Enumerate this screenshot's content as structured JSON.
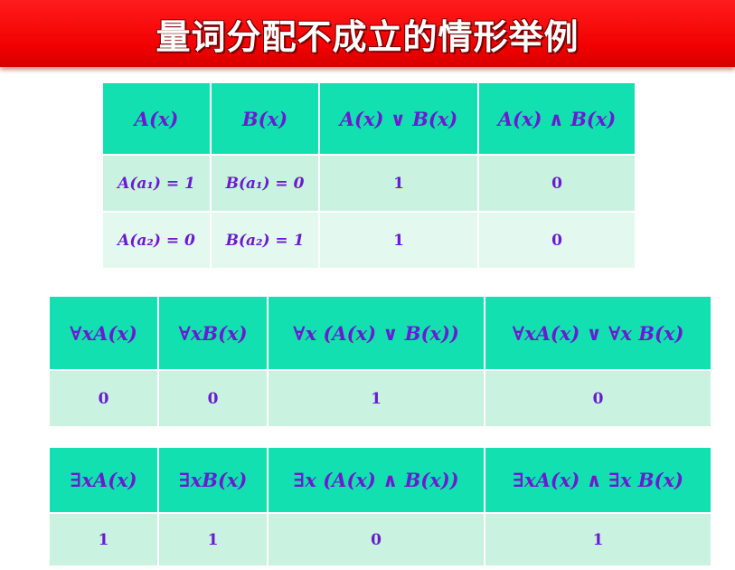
{
  "title": "量词分配不成立的情形举例",
  "colors": {
    "banner": "#f20000",
    "header_cell": "#12e0b0",
    "row_cell": "#c9f2e0",
    "text": "#6a1bd0"
  },
  "table1": {
    "headers": [
      "A(x)",
      "B(x)",
      "A(x) ∨ B(x)",
      "A(x) ∧ B(x)"
    ],
    "rows": [
      [
        "A(a₁) = 1",
        "B(a₁) = 0",
        "1",
        "0"
      ],
      [
        "A(a₂) = 0",
        "B(a₂) = 1",
        "1",
        "0"
      ]
    ]
  },
  "table2": {
    "headers": [
      "∀xA(x)",
      "∀xB(x)",
      "∀x (A(x) ∨ B(x))",
      "∀xA(x) ∨ ∀x B(x)"
    ],
    "rows": [
      [
        "0",
        "0",
        "1",
        "0"
      ]
    ]
  },
  "table3": {
    "headers": [
      "∃xA(x)",
      "∃xB(x)",
      "∃x (A(x) ∧ B(x))",
      "∃xA(x) ∧ ∃x B(x)"
    ],
    "rows": [
      [
        "1",
        "1",
        "0",
        "1"
      ]
    ]
  }
}
